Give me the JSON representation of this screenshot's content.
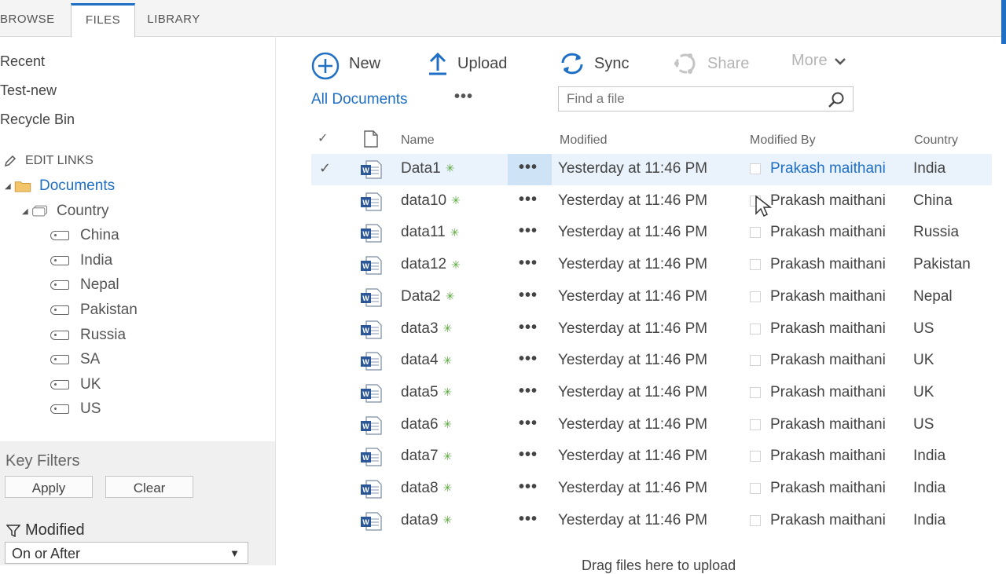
{
  "ribbon": {
    "tabs": [
      {
        "label": "BROWSE"
      },
      {
        "label": "FILES"
      },
      {
        "label": "LIBRARY"
      }
    ]
  },
  "nav": {
    "links": [
      "Recent",
      "Test-new",
      "Recycle Bin"
    ],
    "edit_links": "EDIT LINKS",
    "documents": "Documents",
    "country": "Country",
    "countries": [
      "China",
      "India",
      "Nepal",
      "Pakistan",
      "Russia",
      "SA",
      "UK",
      "US"
    ]
  },
  "key_filters": {
    "title": "Key Filters",
    "apply": "Apply",
    "clear": "Clear",
    "modified_label": "Modified",
    "selected_option": "On or After"
  },
  "commands": {
    "new": "New",
    "upload": "Upload",
    "sync": "Sync",
    "share": "Share",
    "more": "More"
  },
  "view": {
    "name": "All Documents",
    "menu": "•••",
    "search_placeholder": "Find a file"
  },
  "table": {
    "headers": {
      "name": "Name",
      "modified": "Modified",
      "modified_by": "Modified By",
      "country": "Country"
    },
    "rows": [
      {
        "name": "Data1",
        "modified": "Yesterday at 11:46 PM",
        "modified_by": "Prakash maithani",
        "country": "India"
      },
      {
        "name": "data10",
        "modified": "Yesterday at 11:46 PM",
        "modified_by": "Prakash maithani",
        "country": "China"
      },
      {
        "name": "data11",
        "modified": "Yesterday at 11:46 PM",
        "modified_by": "Prakash maithani",
        "country": "Russia"
      },
      {
        "name": "data12",
        "modified": "Yesterday at 11:46 PM",
        "modified_by": "Prakash maithani",
        "country": "Pakistan"
      },
      {
        "name": "Data2",
        "modified": "Yesterday at 11:46 PM",
        "modified_by": "Prakash maithani",
        "country": "Nepal"
      },
      {
        "name": "data3",
        "modified": "Yesterday at 11:46 PM",
        "modified_by": "Prakash maithani",
        "country": "US"
      },
      {
        "name": "data4",
        "modified": "Yesterday at 11:46 PM",
        "modified_by": "Prakash maithani",
        "country": "UK"
      },
      {
        "name": "data5",
        "modified": "Yesterday at 11:46 PM",
        "modified_by": "Prakash maithani",
        "country": "UK"
      },
      {
        "name": "data6",
        "modified": "Yesterday at 11:46 PM",
        "modified_by": "Prakash maithani",
        "country": "US"
      },
      {
        "name": "data7",
        "modified": "Yesterday at 11:46 PM",
        "modified_by": "Prakash maithani",
        "country": "India"
      },
      {
        "name": "data8",
        "modified": "Yesterday at 11:46 PM",
        "modified_by": "Prakash maithani",
        "country": "India"
      },
      {
        "name": "data9",
        "modified": "Yesterday at 11:46 PM",
        "modified_by": "Prakash maithani",
        "country": "India"
      }
    ],
    "selected_row": 0,
    "row_menu": "•••",
    "new_marker": "✳",
    "footer": "Drag files here to upload"
  },
  "colors": {
    "accent": "#1f6fc4",
    "new_marker": "#5aa83b"
  }
}
